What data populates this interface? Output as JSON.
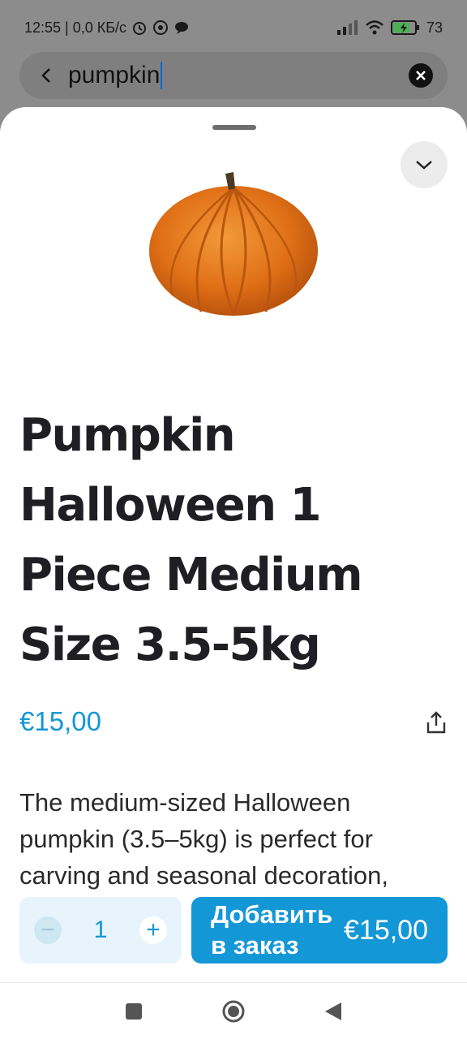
{
  "status_bar": {
    "time_info": "12:55 | 0,0 КБ/с",
    "battery": "73"
  },
  "search": {
    "query": "pumpkin"
  },
  "product": {
    "title_lines": [
      "Pumpkin",
      "Halloween 1",
      "Piece Medium",
      "Size 3.5-5kg"
    ],
    "price": "€15,00",
    "description_lines": [
      "The medium-sized Halloween",
      "pumpkin (3.5–5kg) is perfect for",
      "carving and seasonal decoration,"
    ]
  },
  "cart": {
    "quantity": "1",
    "minus": "−",
    "plus": "+",
    "add_label": "Добавить в заказ",
    "add_price": "€15,00"
  },
  "colors": {
    "accent": "#1497d6",
    "title": "#1f1f23",
    "pumpkin": "#e3741c"
  },
  "icons": [
    "chevron-left-icon",
    "clear-icon",
    "chevron-down-icon",
    "share-icon",
    "nav-recents-icon",
    "nav-home-icon",
    "nav-back-icon"
  ]
}
